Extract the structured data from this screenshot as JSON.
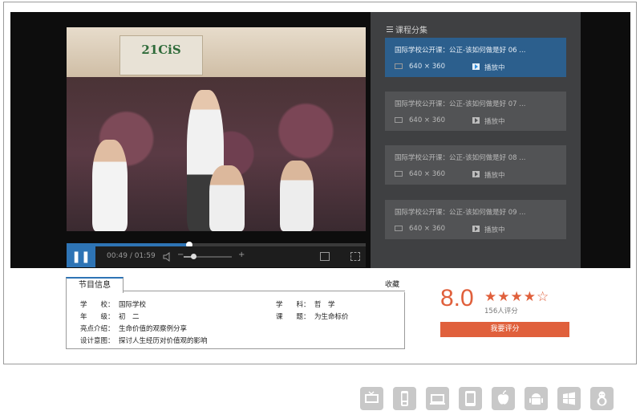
{
  "player": {
    "banner_text": "21CiS",
    "time_current": "00:49",
    "time_separator": "/",
    "time_total": "01:59",
    "progress_fraction": 0.41,
    "volume_fraction": 0.2,
    "volume_minus": "−",
    "volume_plus": "+"
  },
  "sidebar": {
    "title": "课程分集",
    "episodes": [
      {
        "title": "国际学校公开课：公正-该如何做是好 06 ...",
        "resolution": "640 × 360",
        "status": "播放中",
        "active": true
      },
      {
        "title": "国际学校公开课：公正-该如何做是好 07 ...",
        "resolution": "640 × 360",
        "status": "播放中",
        "active": false
      },
      {
        "title": "国际学校公开课：公正-该如何做是好 08 ...",
        "resolution": "640 × 360",
        "status": "播放中",
        "active": false
      },
      {
        "title": "国际学校公开课：公正-该如何做是好 09 ...",
        "resolution": "640 × 360",
        "status": "播放中",
        "active": false
      }
    ]
  },
  "info": {
    "tab_label": "节目信息",
    "favorite": "收藏",
    "school_label": "学　　校：",
    "school_value": "国际学校",
    "subject_label": "学　　科：",
    "subject_value": "哲　学",
    "grade_label": "年　　级：",
    "grade_value": "初　二",
    "topic_label": "课　　题：",
    "topic_value": "为生命标价",
    "highlight_label": "亮点介绍：",
    "highlight_value": "生命价值的观察例分享",
    "design_label": "设计意图：",
    "design_value": "探讨人生经历对价值观的影响"
  },
  "rating": {
    "score": "8.0",
    "stars_filled": 4,
    "stars_total": 5,
    "count": "156人评分",
    "button": "我要评分"
  },
  "colors": {
    "accent_blue": "#2e74b5",
    "accent_orange": "#e0603c"
  },
  "platform_icons": [
    "tv-icon",
    "mobile-phone-icon",
    "laptop-icon",
    "tablet-icon",
    "apple-icon",
    "android-icon",
    "windows-icon",
    "linux-icon"
  ]
}
